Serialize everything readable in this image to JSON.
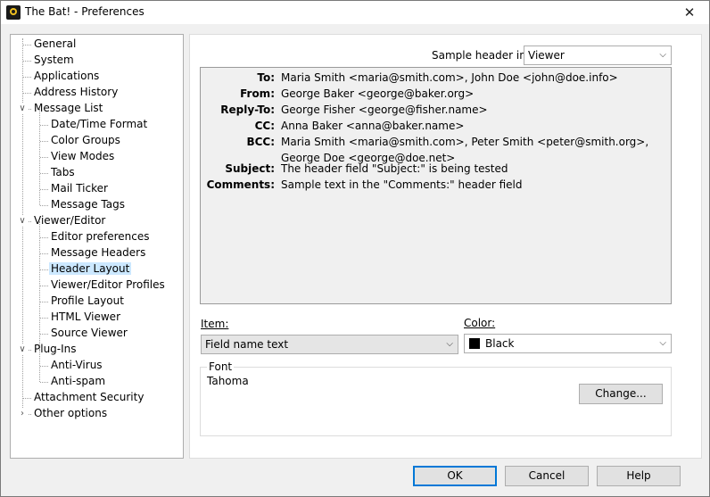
{
  "window": {
    "title": "The Bat! - Preferences",
    "close_glyph": "✕"
  },
  "tree": [
    {
      "label": "General"
    },
    {
      "label": "System"
    },
    {
      "label": "Applications"
    },
    {
      "label": "Address History"
    },
    {
      "label": "Message List"
    },
    {
      "label": "Date/Time Format"
    },
    {
      "label": "Color Groups"
    },
    {
      "label": "View Modes"
    },
    {
      "label": "Tabs"
    },
    {
      "label": "Mail Ticker"
    },
    {
      "label": "Message Tags"
    },
    {
      "label": "Viewer/Editor"
    },
    {
      "label": "Editor preferences"
    },
    {
      "label": "Message Headers"
    },
    {
      "label": "Header Layout"
    },
    {
      "label": "Viewer/Editor Profiles"
    },
    {
      "label": "Profile Layout"
    },
    {
      "label": "HTML Viewer"
    },
    {
      "label": "Source Viewer"
    },
    {
      "label": "Plug-Ins"
    },
    {
      "label": "Anti-Virus"
    },
    {
      "label": "Anti-spam"
    },
    {
      "label": "Attachment Security"
    },
    {
      "label": "Other options"
    }
  ],
  "sample_header": {
    "label": "Sample header in:",
    "value": "Viewer"
  },
  "preview": [
    {
      "name": "To:",
      "value": "Maria Smith <maria@smith.com>, John Doe <john@doe.info>"
    },
    {
      "name": "From:",
      "value": "George Baker <george@baker.org>"
    },
    {
      "name": "Reply-To:",
      "value": "George Fisher <george@fisher.name>"
    },
    {
      "name": "CC:",
      "value": "Anna Baker <anna@baker.name>"
    },
    {
      "name": "BCC:",
      "value": "Maria Smith <maria@smith.com>, Peter Smith <peter@smith.org>, George Doe <george@doe.net>"
    },
    {
      "name": "Subject:",
      "value": "The header field \"Subject:\" is being tested"
    },
    {
      "name": "Comments:",
      "value": "Sample text in the \"Comments:\" header field"
    }
  ],
  "item": {
    "label": "Item:",
    "value": "Field name text"
  },
  "color": {
    "label": "Color:",
    "value": "Black",
    "swatch": "#000000"
  },
  "font": {
    "legend": "Font",
    "name": "Tahoma",
    "change_label": "Change..."
  },
  "buttons": {
    "ok": "OK",
    "cancel": "Cancel",
    "help": "Help"
  },
  "colors": {
    "selection": "#cce8ff",
    "default_button_border": "#0078d7"
  }
}
